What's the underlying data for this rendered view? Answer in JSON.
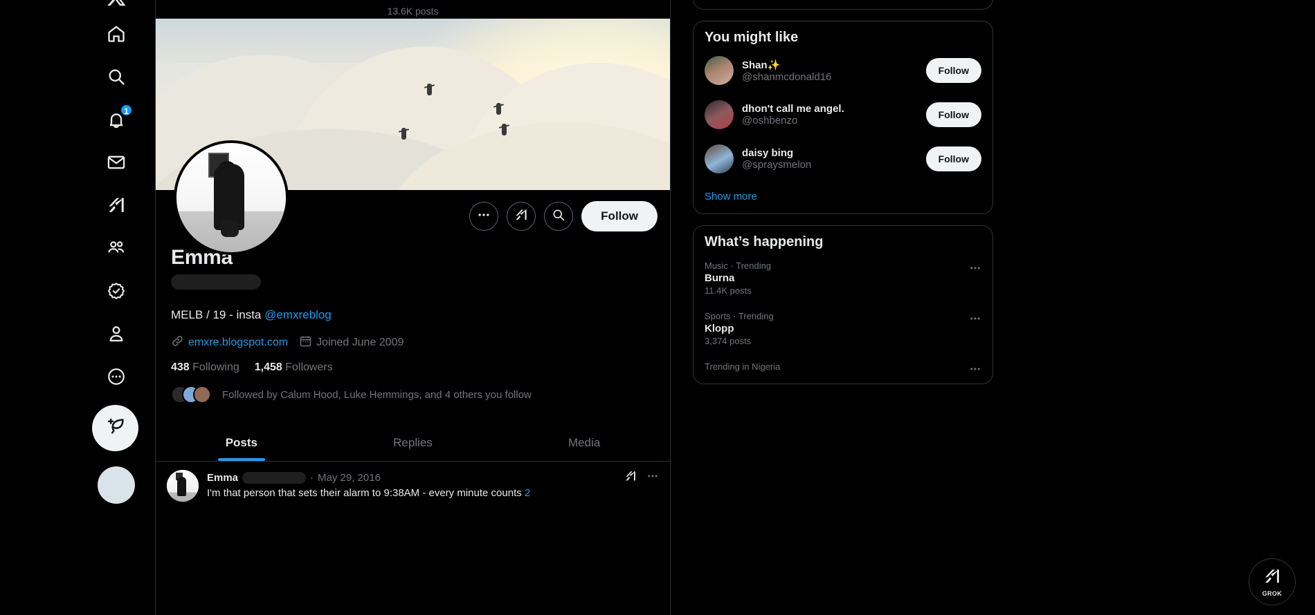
{
  "left_nav": {
    "items": [
      {
        "label": "X",
        "icon": "x-logo-icon"
      },
      {
        "label": "Home",
        "icon": "home-icon"
      },
      {
        "label": "Explore",
        "icon": "search-icon"
      },
      {
        "label": "Notifications",
        "icon": "bell-icon",
        "badge": "1"
      },
      {
        "label": "Messages",
        "icon": "envelope-icon"
      },
      {
        "label": "Grok",
        "icon": "grok-icon"
      },
      {
        "label": "Communities",
        "icon": "people-icon"
      },
      {
        "label": "Premium",
        "icon": "verified-badge-icon"
      },
      {
        "label": "Profile",
        "icon": "person-icon"
      },
      {
        "label": "More",
        "icon": "more-circle-icon"
      }
    ],
    "compose": {
      "label": "Post",
      "icon": "feather-plus-icon"
    }
  },
  "center": {
    "topbar": {
      "posts_count": "13.6K posts"
    },
    "profile": {
      "display_name": "Emma",
      "handle_redacted": true,
      "bio_text": "MELB / 19 - insta ",
      "bio_link": "@emxreblog",
      "website": "emxre.blogspot.com",
      "joined": "Joined June 2009",
      "following_count": "438",
      "following_label": "Following",
      "followers_count": "1,458",
      "followers_label": "Followers",
      "followed_by": "Followed by Calum Hood, Luke Hemmings, and 4 others you follow"
    },
    "actions": {
      "more_label": "More",
      "grok_label": "Grok actions",
      "search_label": "Search profile",
      "follow_label": "Follow"
    },
    "tabs": [
      {
        "label": "Posts",
        "active": true
      },
      {
        "label": "Replies",
        "active": false
      },
      {
        "label": "Media",
        "active": false
      }
    ],
    "post": {
      "author": "Emma",
      "handle_redacted": true,
      "separator": "·",
      "date": "May 29, 2016",
      "text": "I'm that person that sets their alarm to 9:38AM - every minute counts ",
      "text_tail": "2"
    }
  },
  "right": {
    "you_might_like": {
      "title": "You might like",
      "users": [
        {
          "name": "Shan✨",
          "handle": "@shanmcdonald16",
          "follow_label": "Follow"
        },
        {
          "name": "dhon't call me angel.",
          "handle": "@oshbenzo",
          "follow_label": "Follow"
        },
        {
          "name": "daisy bing",
          "handle": "@spraysmelon",
          "follow_label": "Follow"
        }
      ],
      "show_more": "Show more"
    },
    "whats_happening": {
      "title": "What’s happening",
      "trends": [
        {
          "category": "Music · Trending",
          "name": "Burna",
          "count": "11.4K posts"
        },
        {
          "category": "Sports · Trending",
          "name": "Klopp",
          "count": "3,374 posts"
        },
        {
          "category": "Trending in Nigeria",
          "name": "",
          "count": ""
        }
      ]
    }
  },
  "grok_fab": {
    "label": "GROK",
    "icon": "grok-icon"
  },
  "colors": {
    "accent_blue": "#1d9bf0",
    "text_primary": "#e7e9ea",
    "text_secondary": "#71767b",
    "border": "#2f3336",
    "background": "#000000"
  }
}
